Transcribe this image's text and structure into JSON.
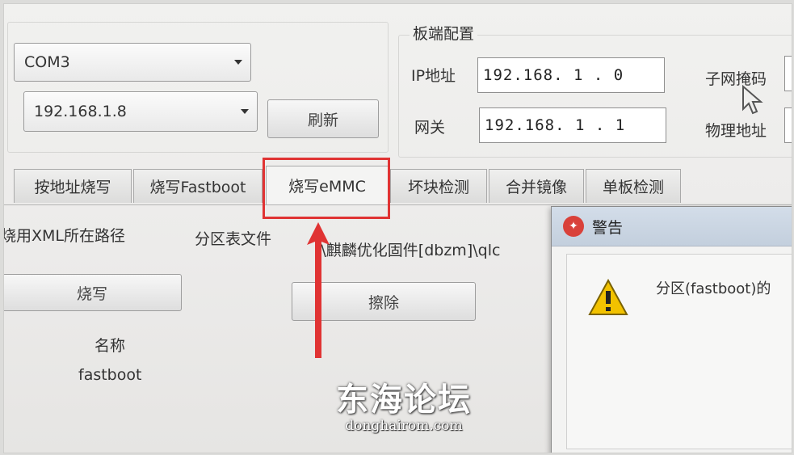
{
  "connection": {
    "com_port": "COM3",
    "ip_select": "192.168.1.8",
    "refresh_label": "刷新"
  },
  "board_config": {
    "title": "板端配置",
    "ip_label": "IP地址",
    "ip_value": "192.168. 1 . 0",
    "gateway_label": "网关",
    "gateway_value": "192.168. 1 . 1",
    "subnet_label": "子网掩码",
    "mac_label": "物理地址"
  },
  "tabs": [
    {
      "label": "按地址烧写"
    },
    {
      "label": "烧写Fastboot"
    },
    {
      "label": "烧写eMMC",
      "active": true
    },
    {
      "label": "坏块检测"
    },
    {
      "label": "合并镜像"
    },
    {
      "label": "单板检测"
    }
  ],
  "emmc_panel": {
    "xml_path_label": "烧用XML所在路径",
    "partition_file_label": "分区表文件",
    "partition_file_value": ":\\麒麟优化固件[dbzm]\\qlc",
    "burn_label": "烧写",
    "erase_label": "擦除",
    "name_header": "名称",
    "rows": [
      "fastboot"
    ]
  },
  "warning_dialog": {
    "title": "警告",
    "message": "分区(fastboot)的"
  },
  "watermark": {
    "main": "东海论坛",
    "sub": "donghairom.com"
  },
  "colors": {
    "highlight": "#e03333",
    "dialog_icon": "#d9413a"
  }
}
